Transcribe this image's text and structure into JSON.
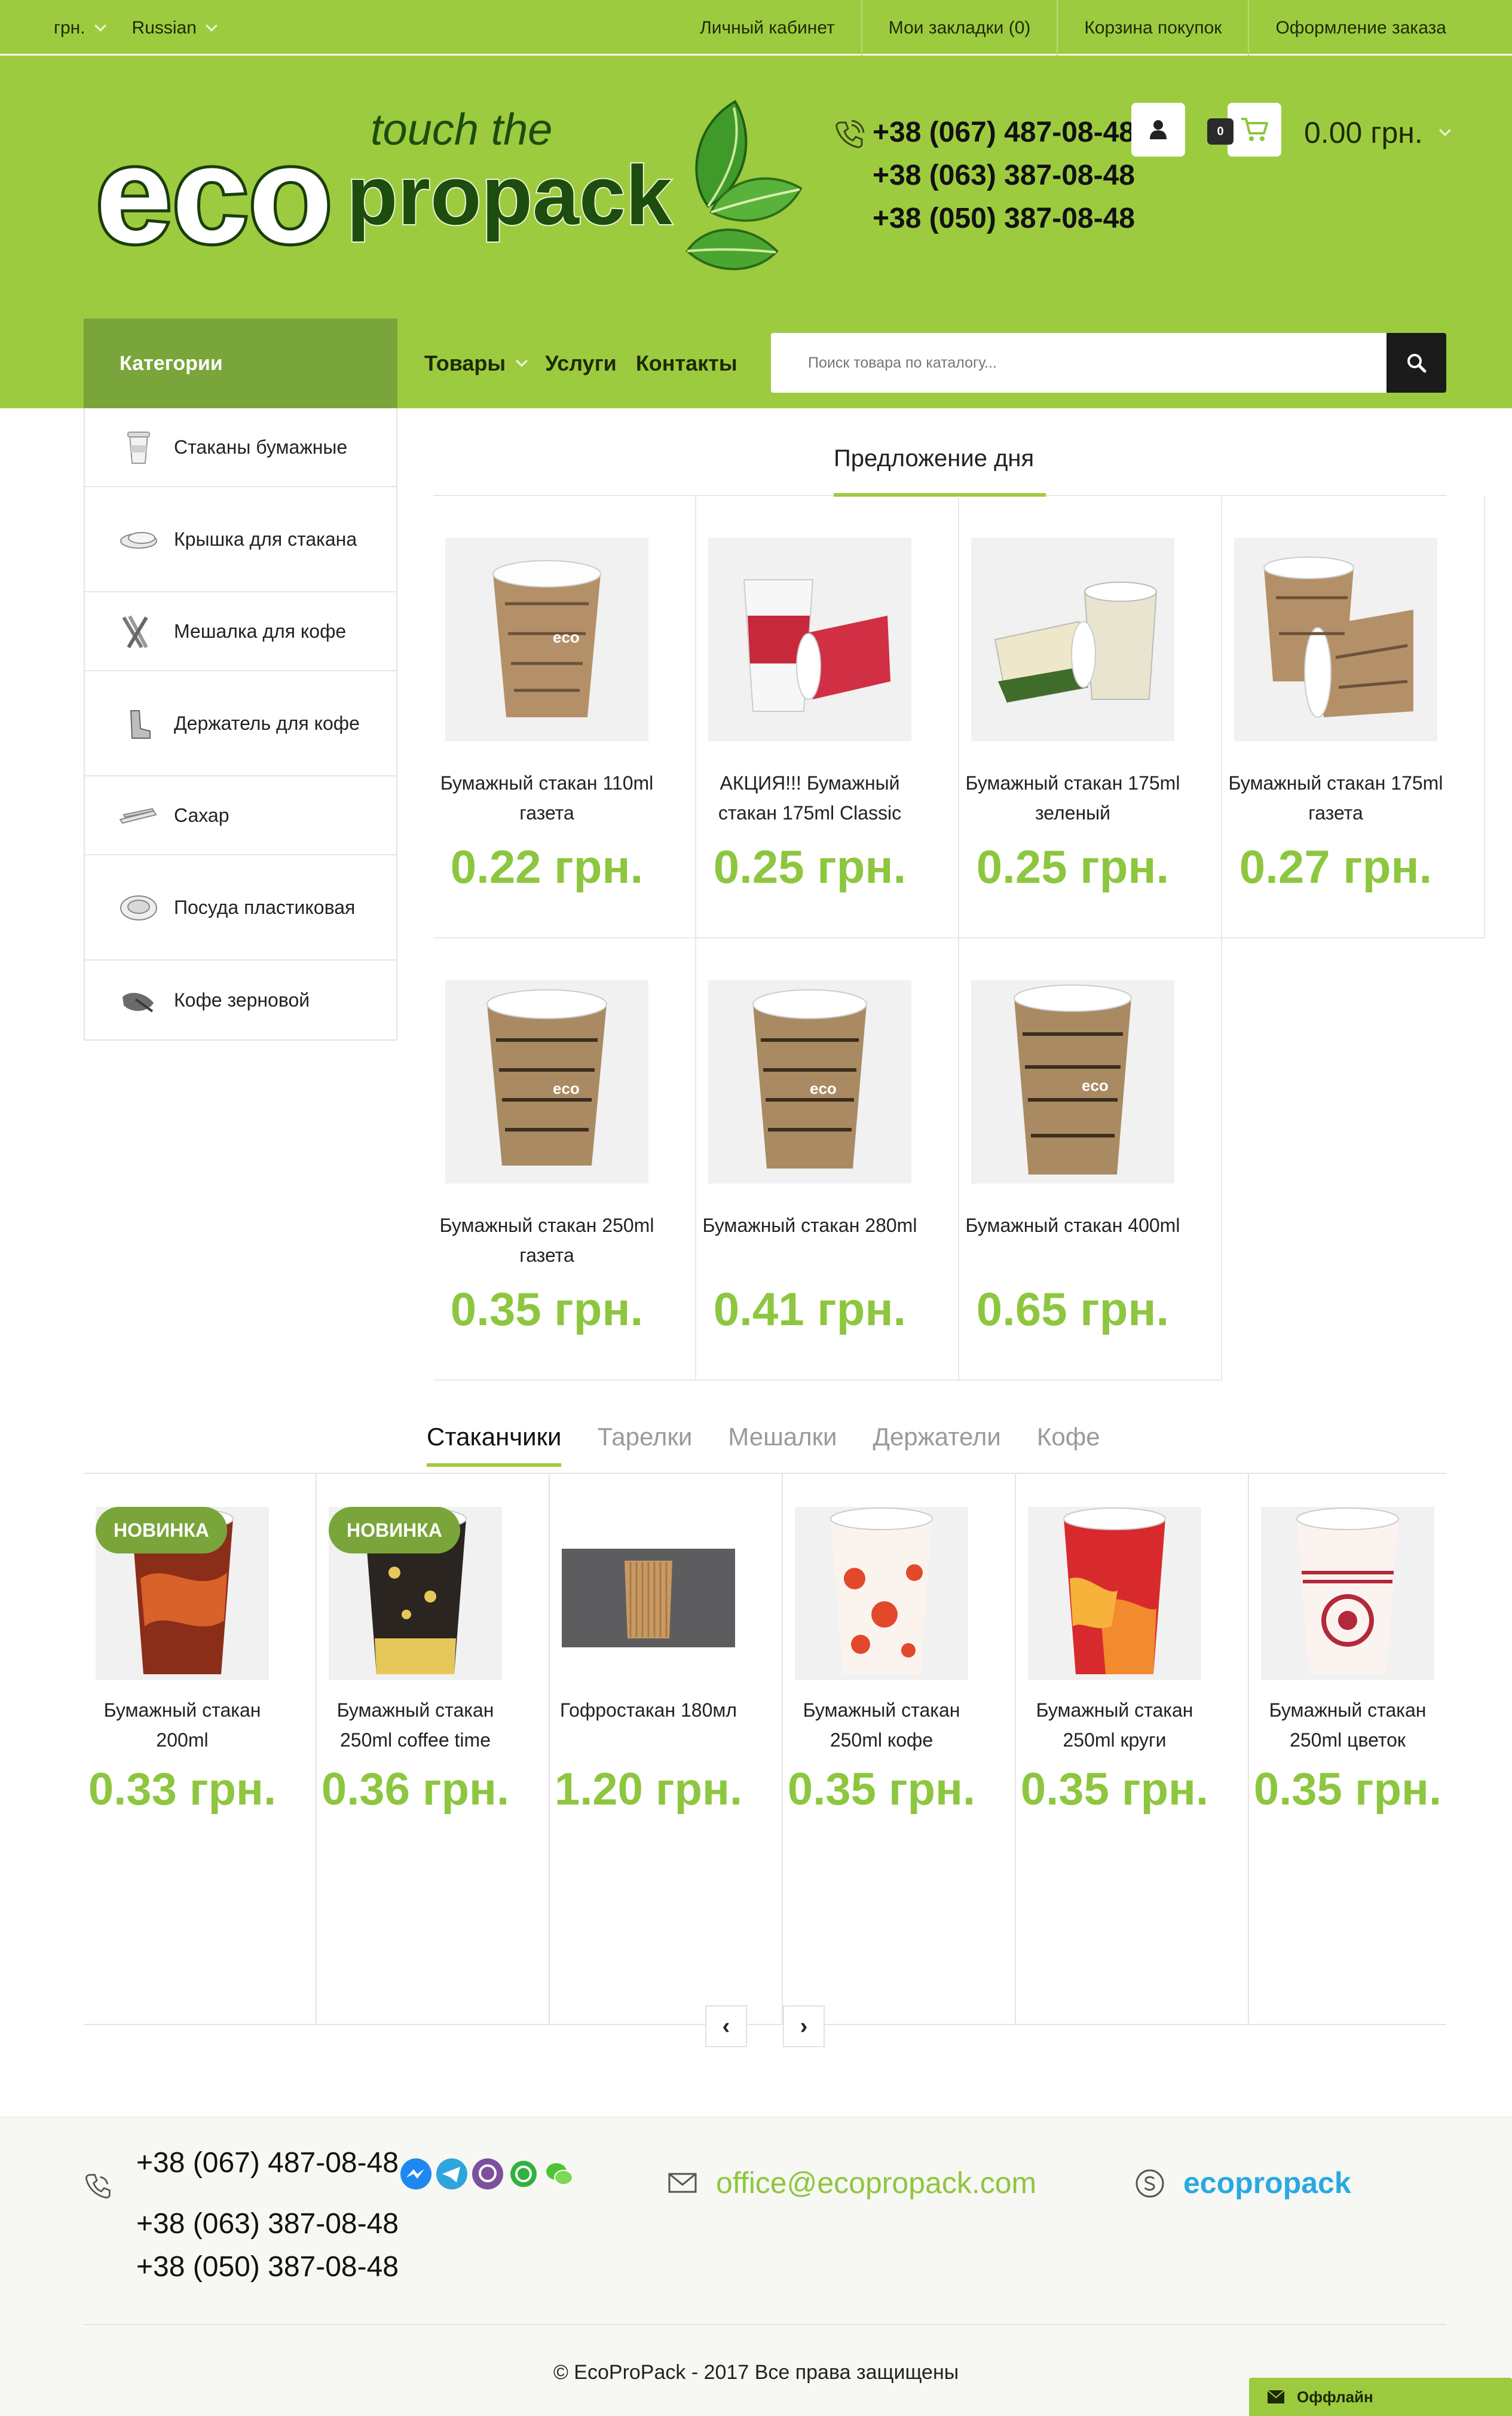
{
  "topbar": {
    "currency": "грн.",
    "language": "Russian",
    "links": [
      "Личный кабинет",
      "Мои закладки (0)",
      "Корзина покупок",
      "Оформление заказа"
    ]
  },
  "header": {
    "logo": {
      "eco": "eco",
      "touch": "touch the",
      "propack": "propack"
    },
    "phones": [
      "+38 (067) 487-08-48",
      "+38 (063) 387-08-48",
      "+38 (050) 387-08-48"
    ],
    "cart_count": "0",
    "cart_total": "0.00 грн."
  },
  "nav": {
    "categories_label": "Категории",
    "items": [
      "Товары",
      "Услуги",
      "Контакты"
    ],
    "search_placeholder": "Поиск товара по каталогу..."
  },
  "sidebar": {
    "items": [
      {
        "label": "Стаканы бумажные",
        "icon": "paper-cup-icon"
      },
      {
        "label": "Крышка для стакана",
        "icon": "cup-lid-icon"
      },
      {
        "label": "Мешалка для кофе",
        "icon": "coffee-stirrer-icon"
      },
      {
        "label": "Держатель для кофе",
        "icon": "cup-holder-icon"
      },
      {
        "label": "Сахар",
        "icon": "sugar-icon"
      },
      {
        "label": "Посуда пластиковая",
        "icon": "plastic-dish-icon"
      },
      {
        "label": "Кофе зерновой",
        "icon": "coffee-beans-icon"
      }
    ]
  },
  "offer": {
    "title": "Предложение дня",
    "products": [
      {
        "name": "Бумажный стакан 110ml газета",
        "price": "0.22 грн."
      },
      {
        "name": "АКЦИЯ!!! Бумажный стакан 175ml Classic",
        "price": "0.25 грн."
      },
      {
        "name": "Бумажный стакан 175ml зеленый",
        "price": "0.25 грн."
      },
      {
        "name": "Бумажный стакан 175ml газета",
        "price": "0.27 грн."
      },
      {
        "name": "Бумажный стакан 250ml газета",
        "price": "0.35 грн."
      },
      {
        "name": "Бумажный стакан 280ml",
        "price": "0.41 грн."
      },
      {
        "name": "Бумажный стакан 400ml",
        "price": "0.65 грн."
      }
    ]
  },
  "tabs": [
    "Стаканчики",
    "Тарелки",
    "Мешалки",
    "Держатели",
    "Кофе"
  ],
  "carousel": {
    "badge": "НОВИНКА",
    "products": [
      {
        "name": "Бумажный стакан 200ml",
        "price": "0.33 грн.",
        "new": true
      },
      {
        "name": "Бумажный стакан 250ml coffee time",
        "price": "0.36 грн.",
        "new": true
      },
      {
        "name": "Гофростакан 180мл",
        "price": "1.20 грн.",
        "new": false
      },
      {
        "name": "Бумажный стакан 250ml кофе",
        "price": "0.35 грн.",
        "new": false
      },
      {
        "name": "Бумажный стакан 250ml круги",
        "price": "0.35 грн.",
        "new": false
      },
      {
        "name": "Бумажный стакан 250ml цветок",
        "price": "0.35 грн.",
        "new": false
      }
    ]
  },
  "footer": {
    "phones": [
      "+38 (067) 487-08-48",
      "+38 (063) 387-08-48",
      "+38 (050) 387-08-48"
    ],
    "messengers": [
      "messenger-icon",
      "telegram-icon",
      "viber-icon",
      "whatsapp-icon",
      "wechat-icon"
    ],
    "email": "office@ecopropack.com",
    "skype": "ecopropack",
    "copyright": "© EcoProPack - 2017 Все права защищены",
    "chat_status": "Оффлайн"
  },
  "colors": {
    "brand_green": "#9dcb3f",
    "dark_green": "#79a53a",
    "price_green": "#8dc63f"
  }
}
